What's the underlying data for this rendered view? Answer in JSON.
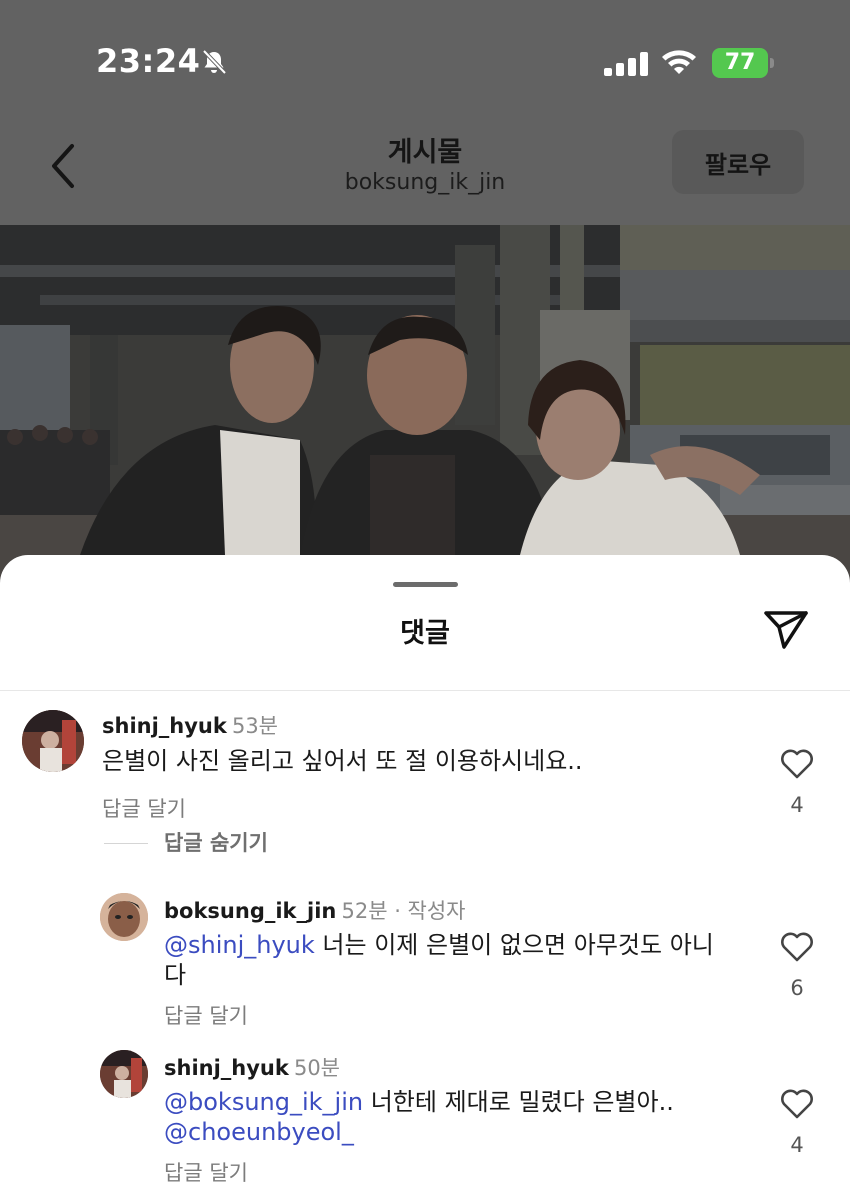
{
  "status_bar": {
    "time": "23:24",
    "battery": "77"
  },
  "header": {
    "title": "게시물",
    "username": "boksung_ik_jin",
    "follow_label": "팔로우"
  },
  "sheet": {
    "title": "댓글"
  },
  "comments": [
    {
      "username": "shinj_hyuk",
      "time": "53분",
      "text": "은별이 사진 올리고 싶어서 또 절 이용하시네요..",
      "reply_label": "답글 달기",
      "likes": "4",
      "hide_replies_label": "답글 숨기기"
    },
    {
      "username": "boksung_ik_jin",
      "time": "52분",
      "author_tag": " · 작성자",
      "mention": "@shinj_hyuk",
      "text": " 너는 이제 은별이 없으면 아무것도 아니",
      "text_line2": "다",
      "reply_label": "답글 달기",
      "likes": "6"
    },
    {
      "username": "shinj_hyuk",
      "time": "50분",
      "mention": "@boksung_ik_jin",
      "text": " 너한테 제대로 밀렸다 은별아..",
      "mention2": "@choeunbyeol_",
      "reply_label": "답글 달기",
      "likes": "4"
    }
  ],
  "colors": {
    "mention": "#3b4cc0",
    "battery": "#54c84f",
    "sheet": "#ffffff"
  },
  "icons": [
    "bell-slash-icon",
    "signal-icon",
    "wifi-icon",
    "battery-icon",
    "back-chevron-icon",
    "share-send-icon",
    "heart-icon"
  ]
}
